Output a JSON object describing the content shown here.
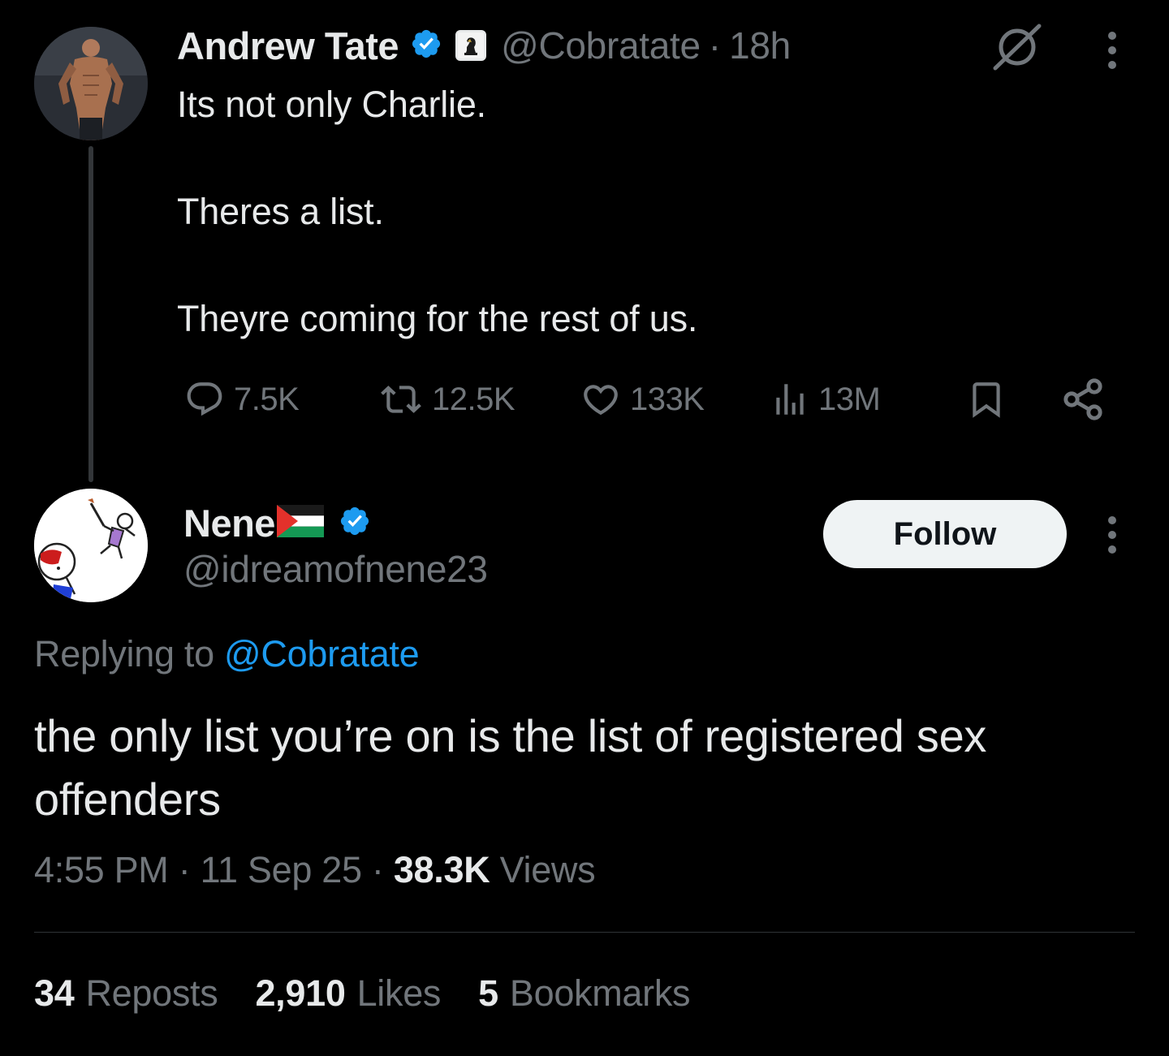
{
  "parent_tweet": {
    "author_name": "Andrew Tate",
    "handle": "@Cobratate",
    "separator": "·",
    "time": "18h",
    "text_lines": [
      "Its not only Charlie.",
      "Theres a list.",
      "Theyre coming for the rest of us."
    ],
    "actions": {
      "replies": "7.5K",
      "reposts": "12.5K",
      "likes": "133K",
      "views": "13M"
    },
    "icons": [
      "verified-badge-icon",
      "affiliate-chess-knight-icon",
      "grok-icon",
      "more-options-icon",
      "reply-icon",
      "repost-icon",
      "like-icon",
      "views-icon",
      "bookmark-icon",
      "share-icon"
    ]
  },
  "reply_tweet": {
    "author_name": "Nene",
    "flag": "🇵🇸",
    "handle": "@idreamofnene23",
    "follow_label": "Follow",
    "replying_prefix": "Replying to",
    "replying_mention": "@Cobratate",
    "text": "the only list you’re on is the list of registered sex offenders",
    "timestamp": "4:55 PM · 11 Sep 25 ·",
    "views_count": "38.3K",
    "views_label": "Views",
    "stats": {
      "reposts_count": "34",
      "reposts_label": "Reposts",
      "likes_count": "2,910",
      "likes_label": "Likes",
      "bookmarks_count": "5",
      "bookmarks_label": "Bookmarks"
    }
  },
  "colors": {
    "background": "#000000",
    "text_primary": "#e7e9ea",
    "text_secondary": "#71767b",
    "accent": "#1d9bf0",
    "divider": "#2f3336"
  }
}
